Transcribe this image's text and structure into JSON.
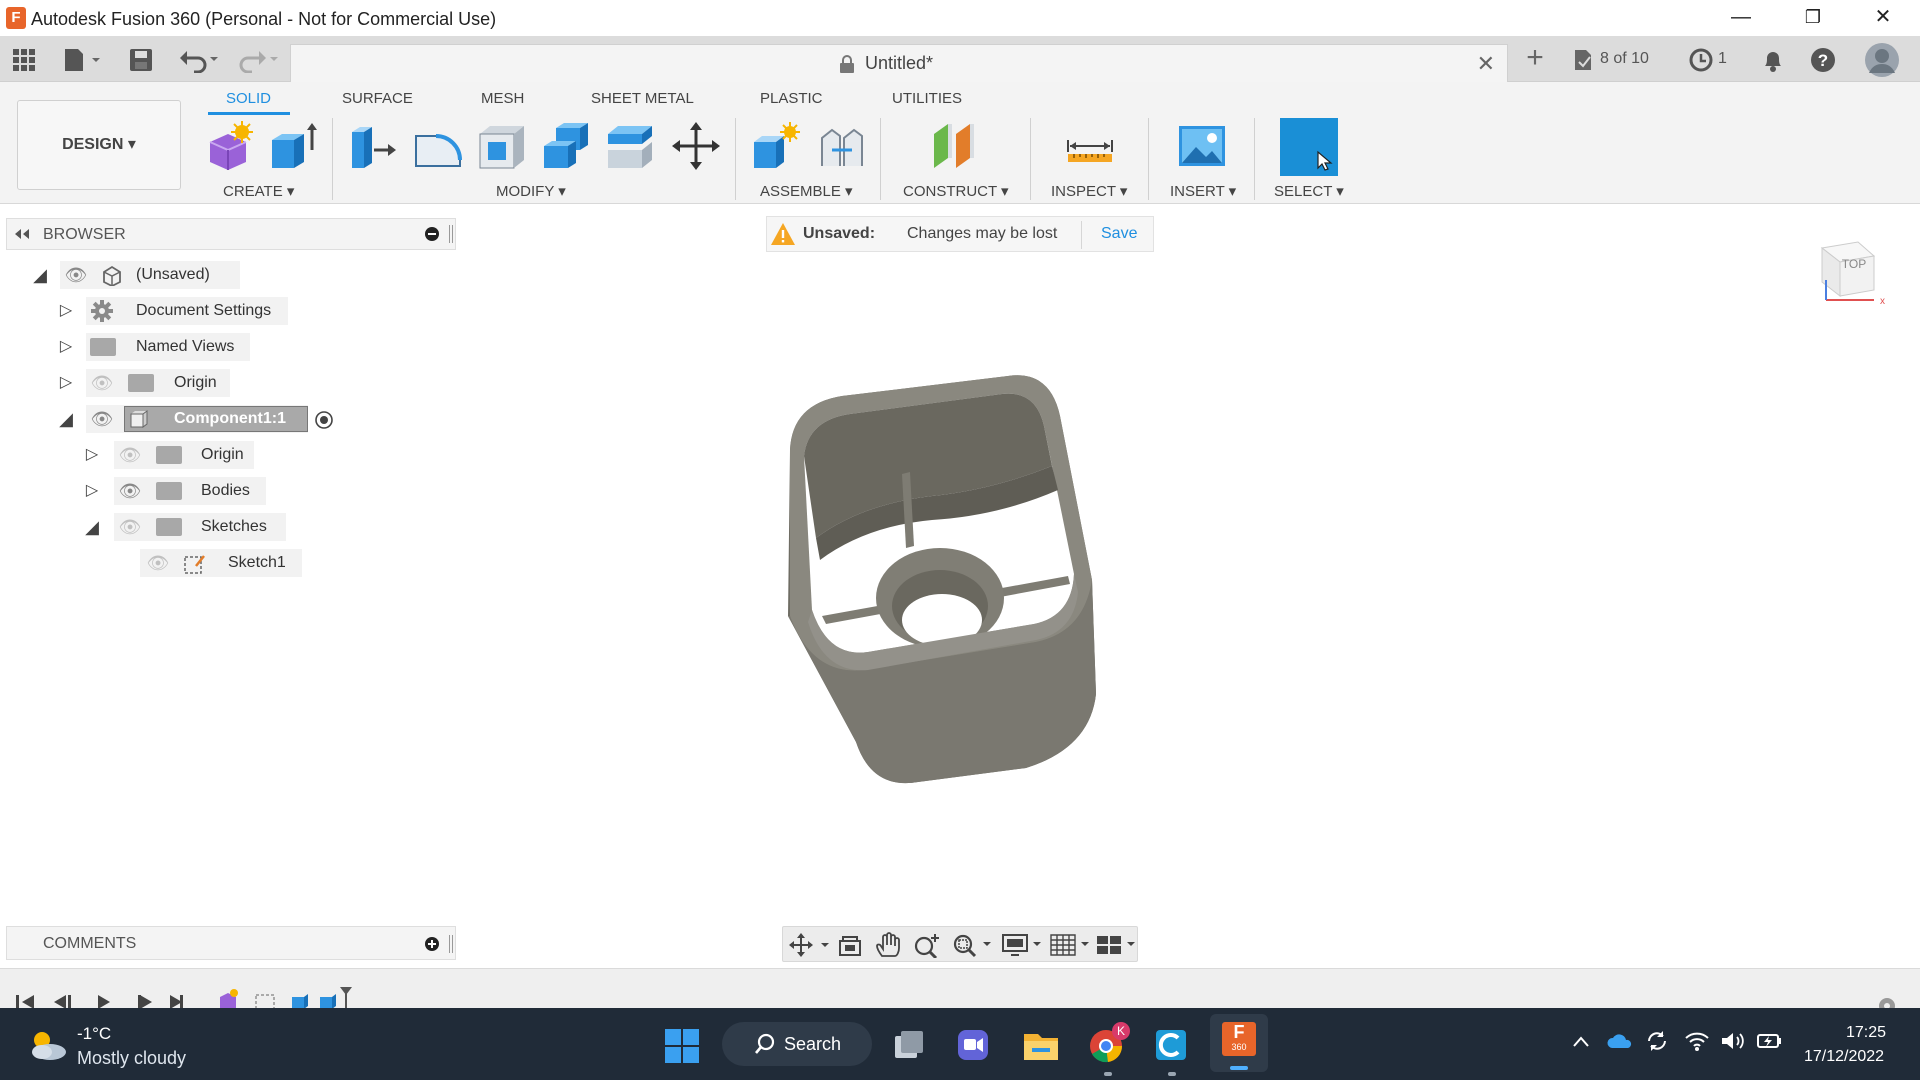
{
  "window": {
    "title": "Autodesk Fusion 360 (Personal - Not for Commercial Use)",
    "logo_letter": "F",
    "minimize": "—",
    "restore": "❐",
    "close": "✕"
  },
  "doc": {
    "tab_title": "Untitled*",
    "tab_close": "✕",
    "new_tab": "+",
    "jobs": "8 of 10",
    "clock_count": "1"
  },
  "workspace": {
    "design_label": "DESIGN ▾"
  },
  "ribbon": {
    "tabs": [
      "SOLID",
      "SURFACE",
      "MESH",
      "SHEET METAL",
      "PLASTIC",
      "UTILITIES"
    ],
    "groups": {
      "create": "CREATE ▾",
      "modify": "MODIFY ▾",
      "assemble": "ASSEMBLE ▾",
      "construct": "CONSTRUCT ▾",
      "inspect": "INSPECT ▾",
      "insert": "INSERT ▾",
      "select": "SELECT ▾"
    }
  },
  "browser": {
    "title": "BROWSER",
    "root": "(Unsaved)",
    "items": {
      "document_settings": "Document Settings",
      "named_views": "Named Views",
      "origin": "Origin",
      "component": "Component1:1",
      "comp_origin": "Origin",
      "bodies": "Bodies",
      "sketches": "Sketches",
      "sketch1": "Sketch1"
    }
  },
  "banner": {
    "status": "Unsaved:",
    "message": "Changes may be lost",
    "save": "Save"
  },
  "viewcube": {
    "face": "TOP"
  },
  "comments": {
    "title": "COMMENTS"
  },
  "taskbar": {
    "temperature": "-1°C",
    "weather": "Mostly cloudy",
    "search": "Search",
    "time": "17:25",
    "date": "17/12/2022",
    "chrome_badge": "K",
    "fusion_sub": "360"
  }
}
